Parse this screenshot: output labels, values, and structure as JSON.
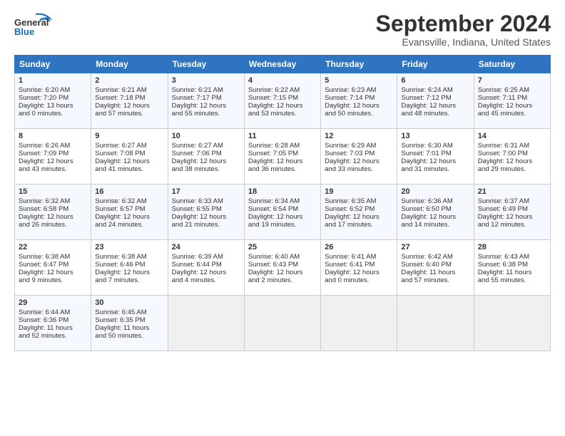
{
  "header": {
    "logo_line1": "General",
    "logo_line2": "Blue",
    "month": "September 2024",
    "location": "Evansville, Indiana, United States"
  },
  "weekdays": [
    "Sunday",
    "Monday",
    "Tuesday",
    "Wednesday",
    "Thursday",
    "Friday",
    "Saturday"
  ],
  "weeks": [
    [
      {
        "day": "1",
        "info": "Sunrise: 6:20 AM\nSunset: 7:20 PM\nDaylight: 13 hours\nand 0 minutes."
      },
      {
        "day": "2",
        "info": "Sunrise: 6:21 AM\nSunset: 7:18 PM\nDaylight: 12 hours\nand 57 minutes."
      },
      {
        "day": "3",
        "info": "Sunrise: 6:21 AM\nSunset: 7:17 PM\nDaylight: 12 hours\nand 55 minutes."
      },
      {
        "day": "4",
        "info": "Sunrise: 6:22 AM\nSunset: 7:15 PM\nDaylight: 12 hours\nand 53 minutes."
      },
      {
        "day": "5",
        "info": "Sunrise: 6:23 AM\nSunset: 7:14 PM\nDaylight: 12 hours\nand 50 minutes."
      },
      {
        "day": "6",
        "info": "Sunrise: 6:24 AM\nSunset: 7:12 PM\nDaylight: 12 hours\nand 48 minutes."
      },
      {
        "day": "7",
        "info": "Sunrise: 6:25 AM\nSunset: 7:11 PM\nDaylight: 12 hours\nand 45 minutes."
      }
    ],
    [
      {
        "day": "8",
        "info": "Sunrise: 6:26 AM\nSunset: 7:09 PM\nDaylight: 12 hours\nand 43 minutes."
      },
      {
        "day": "9",
        "info": "Sunrise: 6:27 AM\nSunset: 7:08 PM\nDaylight: 12 hours\nand 41 minutes."
      },
      {
        "day": "10",
        "info": "Sunrise: 6:27 AM\nSunset: 7:06 PM\nDaylight: 12 hours\nand 38 minutes."
      },
      {
        "day": "11",
        "info": "Sunrise: 6:28 AM\nSunset: 7:05 PM\nDaylight: 12 hours\nand 36 minutes."
      },
      {
        "day": "12",
        "info": "Sunrise: 6:29 AM\nSunset: 7:03 PM\nDaylight: 12 hours\nand 33 minutes."
      },
      {
        "day": "13",
        "info": "Sunrise: 6:30 AM\nSunset: 7:01 PM\nDaylight: 12 hours\nand 31 minutes."
      },
      {
        "day": "14",
        "info": "Sunrise: 6:31 AM\nSunset: 7:00 PM\nDaylight: 12 hours\nand 29 minutes."
      }
    ],
    [
      {
        "day": "15",
        "info": "Sunrise: 6:32 AM\nSunset: 6:58 PM\nDaylight: 12 hours\nand 26 minutes."
      },
      {
        "day": "16",
        "info": "Sunrise: 6:32 AM\nSunset: 6:57 PM\nDaylight: 12 hours\nand 24 minutes."
      },
      {
        "day": "17",
        "info": "Sunrise: 6:33 AM\nSunset: 6:55 PM\nDaylight: 12 hours\nand 21 minutes."
      },
      {
        "day": "18",
        "info": "Sunrise: 6:34 AM\nSunset: 6:54 PM\nDaylight: 12 hours\nand 19 minutes."
      },
      {
        "day": "19",
        "info": "Sunrise: 6:35 AM\nSunset: 6:52 PM\nDaylight: 12 hours\nand 17 minutes."
      },
      {
        "day": "20",
        "info": "Sunrise: 6:36 AM\nSunset: 6:50 PM\nDaylight: 12 hours\nand 14 minutes."
      },
      {
        "day": "21",
        "info": "Sunrise: 6:37 AM\nSunset: 6:49 PM\nDaylight: 12 hours\nand 12 minutes."
      }
    ],
    [
      {
        "day": "22",
        "info": "Sunrise: 6:38 AM\nSunset: 6:47 PM\nDaylight: 12 hours\nand 9 minutes."
      },
      {
        "day": "23",
        "info": "Sunrise: 6:38 AM\nSunset: 6:46 PM\nDaylight: 12 hours\nand 7 minutes."
      },
      {
        "day": "24",
        "info": "Sunrise: 6:39 AM\nSunset: 6:44 PM\nDaylight: 12 hours\nand 4 minutes."
      },
      {
        "day": "25",
        "info": "Sunrise: 6:40 AM\nSunset: 6:43 PM\nDaylight: 12 hours\nand 2 minutes."
      },
      {
        "day": "26",
        "info": "Sunrise: 6:41 AM\nSunset: 6:41 PM\nDaylight: 12 hours\nand 0 minutes."
      },
      {
        "day": "27",
        "info": "Sunrise: 6:42 AM\nSunset: 6:40 PM\nDaylight: 11 hours\nand 57 minutes."
      },
      {
        "day": "28",
        "info": "Sunrise: 6:43 AM\nSunset: 6:38 PM\nDaylight: 11 hours\nand 55 minutes."
      }
    ],
    [
      {
        "day": "29",
        "info": "Sunrise: 6:44 AM\nSunset: 6:36 PM\nDaylight: 11 hours\nand 52 minutes."
      },
      {
        "day": "30",
        "info": "Sunrise: 6:45 AM\nSunset: 6:35 PM\nDaylight: 11 hours\nand 50 minutes."
      },
      {
        "day": "",
        "info": ""
      },
      {
        "day": "",
        "info": ""
      },
      {
        "day": "",
        "info": ""
      },
      {
        "day": "",
        "info": ""
      },
      {
        "day": "",
        "info": ""
      }
    ]
  ]
}
